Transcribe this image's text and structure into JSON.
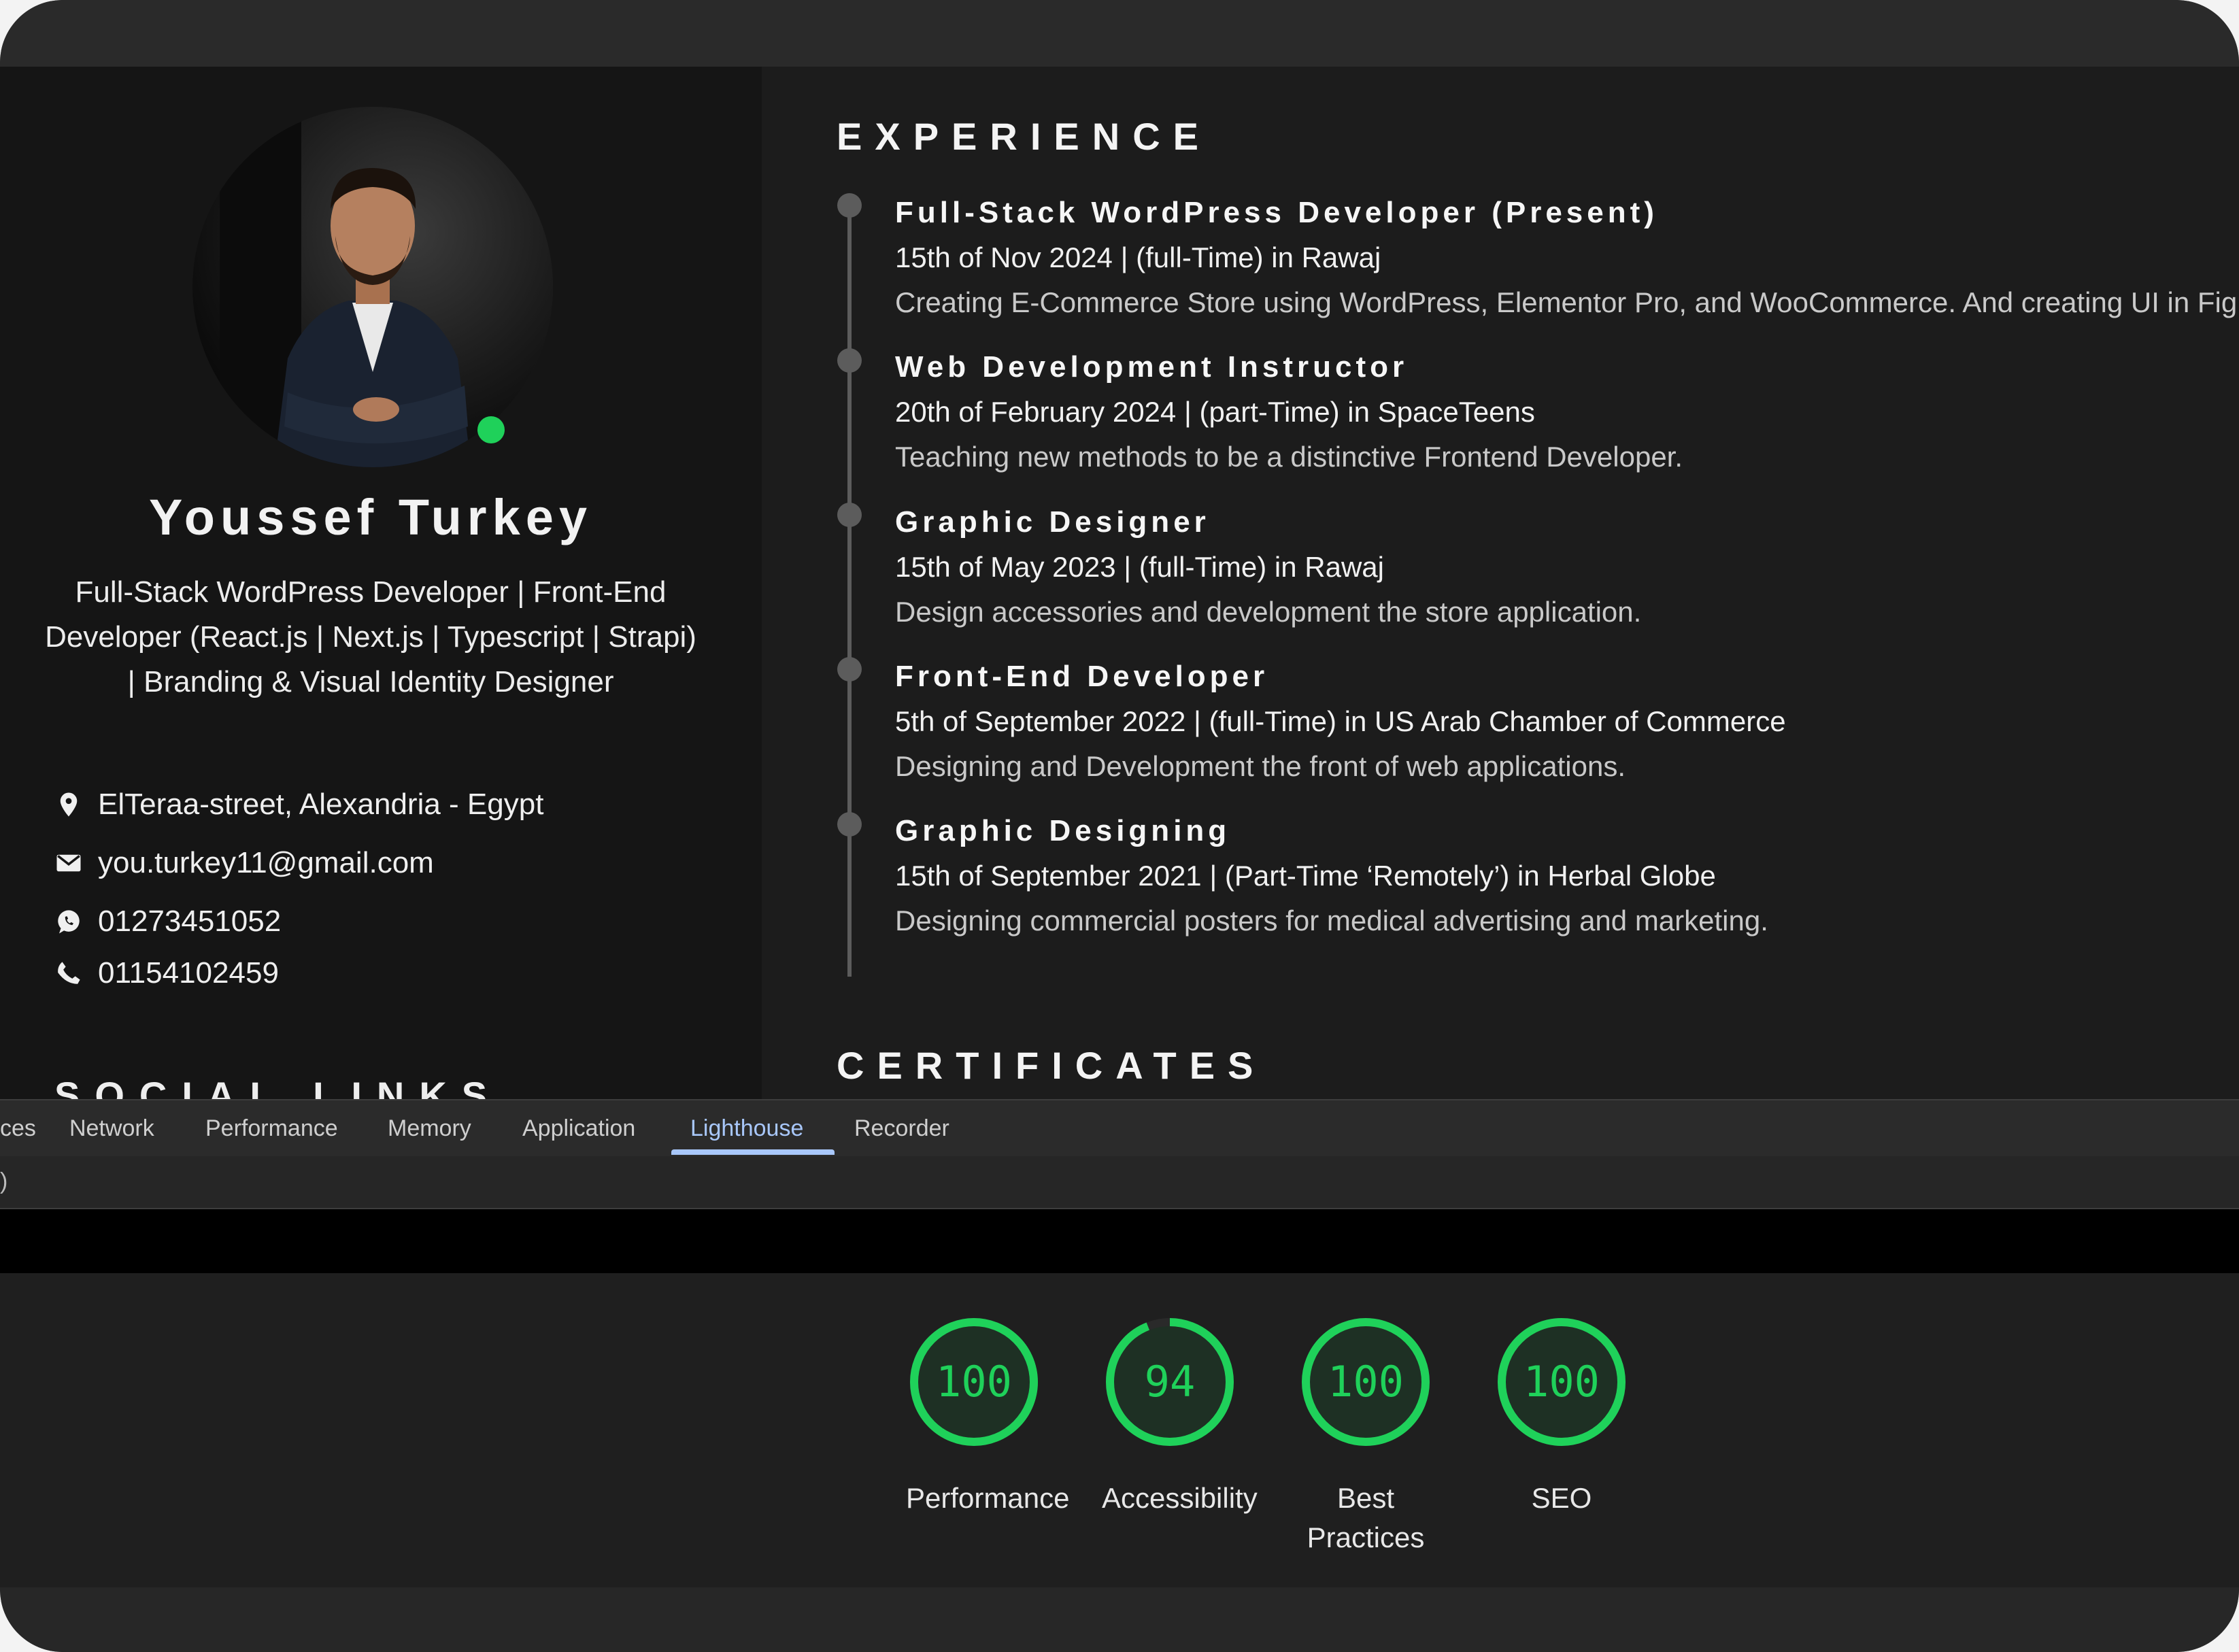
{
  "profile": {
    "name": "Youssef Turkey",
    "headline": [
      "Full-Stack WordPress Developer | Front-End",
      "Developer (React.js | Next.js | Typescript | Strapi)",
      "| Branding & Visual Identity Designer"
    ],
    "location": "ElTeraa-street, Alexandria - Egypt",
    "email": "you.turkey11@gmail.com",
    "whatsapp": "01273451052",
    "phone": "01154102459",
    "social_title": "SOCIAL LINKS",
    "status_color": "#1fd15a"
  },
  "experience": {
    "title": "EXPERIENCE",
    "jobs": [
      {
        "title": "Full-Stack WordPress Developer (Present)",
        "meta": "15th of Nov 2024 | (full-Time) in Rawaj",
        "desc": "Creating E-Commerce Store using WordPress, Elementor Pro, and WooCommerce. And creating UI in Fig"
      },
      {
        "title": "Web Development Instructor",
        "meta": "20th of February 2024 | (part-Time) in SpaceTeens",
        "desc": "Teaching new methods to be a distinctive Frontend Developer."
      },
      {
        "title": "Graphic Designer",
        "meta": "15th of May 2023 | (full-Time) in Rawaj",
        "desc": "Design accessories and development the store application."
      },
      {
        "title": "Front-End Developer",
        "meta": "5th of September 2022 | (full-Time) in US Arab Chamber of Commerce",
        "desc": "Designing and Development the front of web applications."
      },
      {
        "title": "Graphic Designing",
        "meta": "15th of September 2021 | (Part-Time ‘Remotely’) in Herbal Globe",
        "desc": "Designing commercial posters for medical advertising and marketing."
      }
    ]
  },
  "certificates": {
    "title": "CERTIFICATES"
  },
  "devtools": {
    "tabs": [
      "ces",
      "Network",
      "Performance",
      "Memory",
      "Application",
      "Lighthouse",
      "Recorder"
    ],
    "active_tab": "Lighthouse",
    "toolbar_fragment": ")",
    "scores": [
      {
        "label": "Performance",
        "score": 100
      },
      {
        "label": "Accessibility",
        "score": 94
      },
      {
        "label": "Best Practices",
        "score": 100
      },
      {
        "label": "SEO",
        "score": 100
      }
    ],
    "score_color": "#1fd15a"
  }
}
